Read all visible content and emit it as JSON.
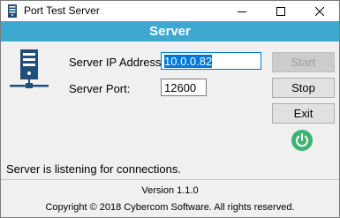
{
  "window": {
    "title": "Port Test Server",
    "controls": [
      "minimize",
      "maximize",
      "close"
    ]
  },
  "banner": {
    "title": "Server"
  },
  "form": {
    "ip_label": "Server IP Address:",
    "ip_value": "10.0.0.82",
    "port_label": "Server Port:",
    "port_value": "12600"
  },
  "buttons": {
    "start": {
      "label": "Start",
      "enabled": false
    },
    "stop": {
      "label": "Stop",
      "enabled": true
    },
    "exit": {
      "label": "Exit",
      "enabled": true
    }
  },
  "power_status": {
    "icon": "power-icon",
    "color": "#3cb371"
  },
  "status_text": "Server is listening for connections.",
  "footer": {
    "version": "Version 1.1.0",
    "copyright": "Copyright © 2018 Cybercom Software. All rights reserved."
  },
  "colors": {
    "banner": "#3ea8d0",
    "selection": "#0078d7",
    "power": "#3cb371"
  }
}
